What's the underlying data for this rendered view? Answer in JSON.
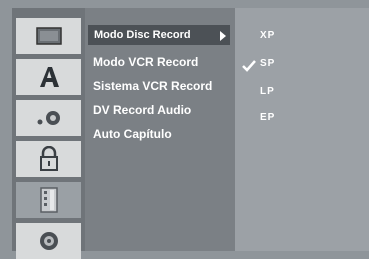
{
  "sidebar": {
    "items": [
      {
        "icon": "disc-icon"
      },
      {
        "icon": "letter-a-icon"
      },
      {
        "icon": "audio-icon"
      },
      {
        "icon": "lock-icon"
      },
      {
        "icon": "record-film-icon",
        "active": true
      },
      {
        "icon": "dvd-disc-icon"
      }
    ]
  },
  "menu": {
    "items": [
      {
        "label": "Modo Disc Record",
        "highlighted": true
      },
      {
        "label": "Modo VCR Record"
      },
      {
        "label": "Sistema VCR Record"
      },
      {
        "label": "DV Record Audio"
      },
      {
        "label": "Auto Capítulo"
      }
    ]
  },
  "options": {
    "items": [
      "XP",
      "SP",
      "LP",
      "EP"
    ],
    "selected": "SP"
  },
  "colors": {
    "background": "#8f959a",
    "highlight": "#4c5156",
    "text": "#ffffff"
  }
}
